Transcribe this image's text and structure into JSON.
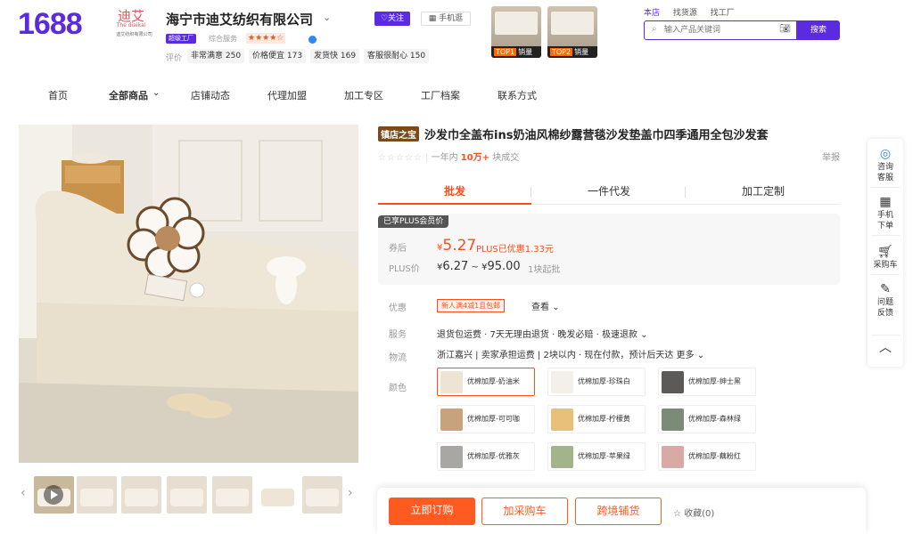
{
  "header": {
    "logo": "1688",
    "shop_avatar_text": "迪艾",
    "shop_avatar_sub": "The diaikai",
    "shop_avatar_caption": "迪艾纺织有限公司",
    "shop_name": "海宁市迪艾纺织有限公司",
    "badge": "超级工厂",
    "service_label": "综合服务",
    "rating_stars": "★★★★☆",
    "eval_label": "评价",
    "eval_tags": [
      "非常满意 250",
      "价格便宜 173",
      "发货快 169",
      "客服很耐心 150"
    ],
    "follow_label": "♡关注",
    "mobile_label": "手机逛",
    "top_items": [
      {
        "rank": "TOP1",
        "label": "销量"
      },
      {
        "rank": "TOP2",
        "label": "销量"
      }
    ],
    "search_tabs": [
      "本店",
      "找货源",
      "找工厂"
    ],
    "search_placeholder": "输入产品关键词",
    "search_button": "搜索"
  },
  "nav": [
    "首页",
    "全部商品",
    "店铺动态",
    "代理加盟",
    "加工专区",
    "工厂档案",
    "联系方式"
  ],
  "product": {
    "tag": "镇店之宝",
    "title": "沙发巾全盖布ins奶油风棉纱露营毯沙发垫盖巾四季通用全包沙发套",
    "rating_stars": "☆☆☆☆☆",
    "sales_prefix": "一年内",
    "sales_value": "10万+",
    "sales_suffix": "块成交",
    "report": "举报"
  },
  "price_tabs": [
    "批发",
    "一件代发",
    "加工定制"
  ],
  "price": {
    "plus_badge": "已享PLUS会员价",
    "coupon_label": "券后",
    "coupon_currency": "¥",
    "coupon_price": "5.27",
    "plus_saving": "PLUS已优惠1.33元",
    "plus_label": "PLUS价",
    "range_low": "6.27",
    "range_high": "95.00",
    "moq": "1块起批"
  },
  "details": {
    "promo_label": "优惠",
    "promo_tag": "新人满4减1且包邮",
    "promo_more": "查看",
    "service_label": "服务",
    "service_value": "退货包运费 · 7天无理由退货 · 晚发必赔 · 极速退款",
    "logistics_label": "物流",
    "logistics_value": "浙江嘉兴 | 卖家承担运费 | 2块以内 · 现在付款，预计后天达 更多",
    "color_label": "颜色"
  },
  "skus": [
    {
      "name": "优棉加厚-奶油米",
      "color": "#ede4d3"
    },
    {
      "name": "优棉加厚-珍珠白",
      "color": "#f3f0ea"
    },
    {
      "name": "优棉加厚-绅士黑",
      "color": "#5c5a58"
    },
    {
      "name": "优棉加厚-可可咖",
      "color": "#c7a27d"
    },
    {
      "name": "优棉加厚-柠檬黄",
      "color": "#e8c07a"
    },
    {
      "name": "优棉加厚-森林绿",
      "color": "#7c8a78"
    },
    {
      "name": "优棉加厚-优雅灰",
      "color": "#a8a7a4"
    },
    {
      "name": "优棉加厚-苹果绿",
      "color": "#a3b38c"
    },
    {
      "name": "优棉加厚-藕粉红",
      "color": "#d9a9a5"
    }
  ],
  "side": [
    {
      "label1": "咨询",
      "label2": "客服",
      "icon": "chat-icon"
    },
    {
      "label1": "手机",
      "label2": "下单",
      "icon": "qrcode-icon"
    },
    {
      "label1": "采购车",
      "label2": "",
      "icon": "cart-icon"
    },
    {
      "label1": "问题",
      "label2": "反馈",
      "icon": "edit-icon"
    }
  ],
  "bottom": {
    "buy": "立即订购",
    "cart": "加采购车",
    "cross": "跨境铺货",
    "fav": "☆ 收藏(0)"
  },
  "colors": {
    "brand": "#5b2be0",
    "accent": "#ff4d1a"
  }
}
